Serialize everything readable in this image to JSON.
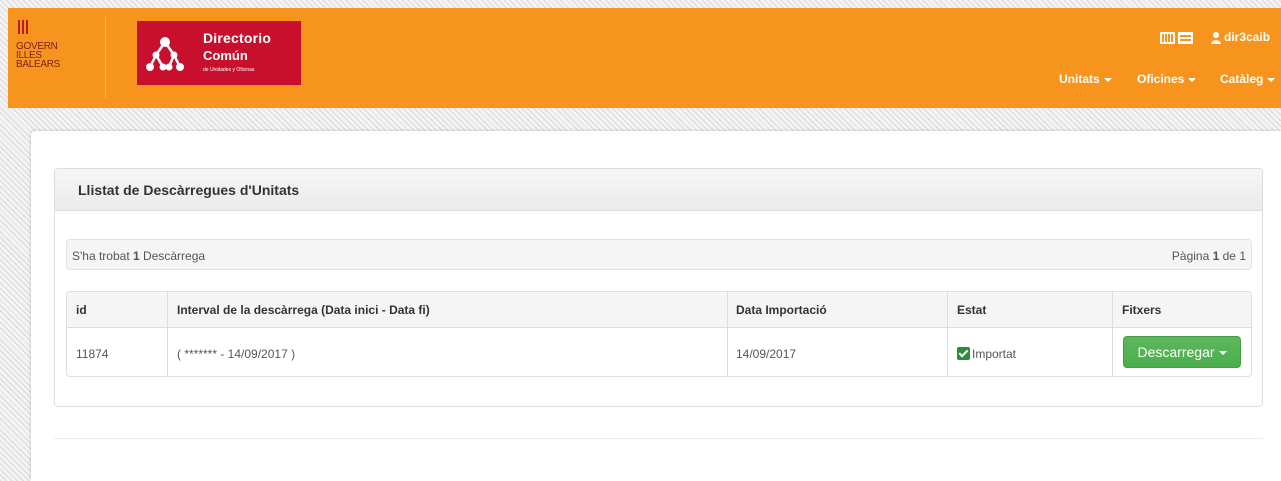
{
  "header": {
    "govern_logo": {
      "lines": [
        "GOVERN",
        "ILLES",
        "BALEARS"
      ]
    },
    "directorio_logo": {
      "title_line1": "Directorio",
      "title_line2": "Común",
      "subtitle": "de Unidades y Oficinas"
    },
    "user": {
      "name": "dir3caib",
      "icon": "user-icon"
    },
    "view_icons": [
      "grid-icon",
      "list-icon"
    ],
    "nav": [
      {
        "label": "Unitats"
      },
      {
        "label": "Oficines"
      },
      {
        "label": "Catàleg"
      }
    ],
    "accent_color": "#f7941d"
  },
  "panel": {
    "title": "Llistat de Descàrregues d'Unitats",
    "info": {
      "found_prefix": "S'ha trobat ",
      "found_count": "1",
      "found_suffix": " Descàrrega",
      "page_prefix": "Pàgina ",
      "page_current": "1",
      "page_sep": " de ",
      "page_total": "1"
    },
    "table": {
      "headers": [
        "id",
        "Interval de la descàrrega (Data inici - Data fi)",
        "Data Importació",
        "Estat",
        "Fitxers"
      ],
      "rows": [
        {
          "id": "11874",
          "interval": "( ******* - 14/09/2017 )",
          "import_date": "14/09/2017",
          "status": "Importat",
          "action": "Descarregar"
        }
      ]
    }
  }
}
